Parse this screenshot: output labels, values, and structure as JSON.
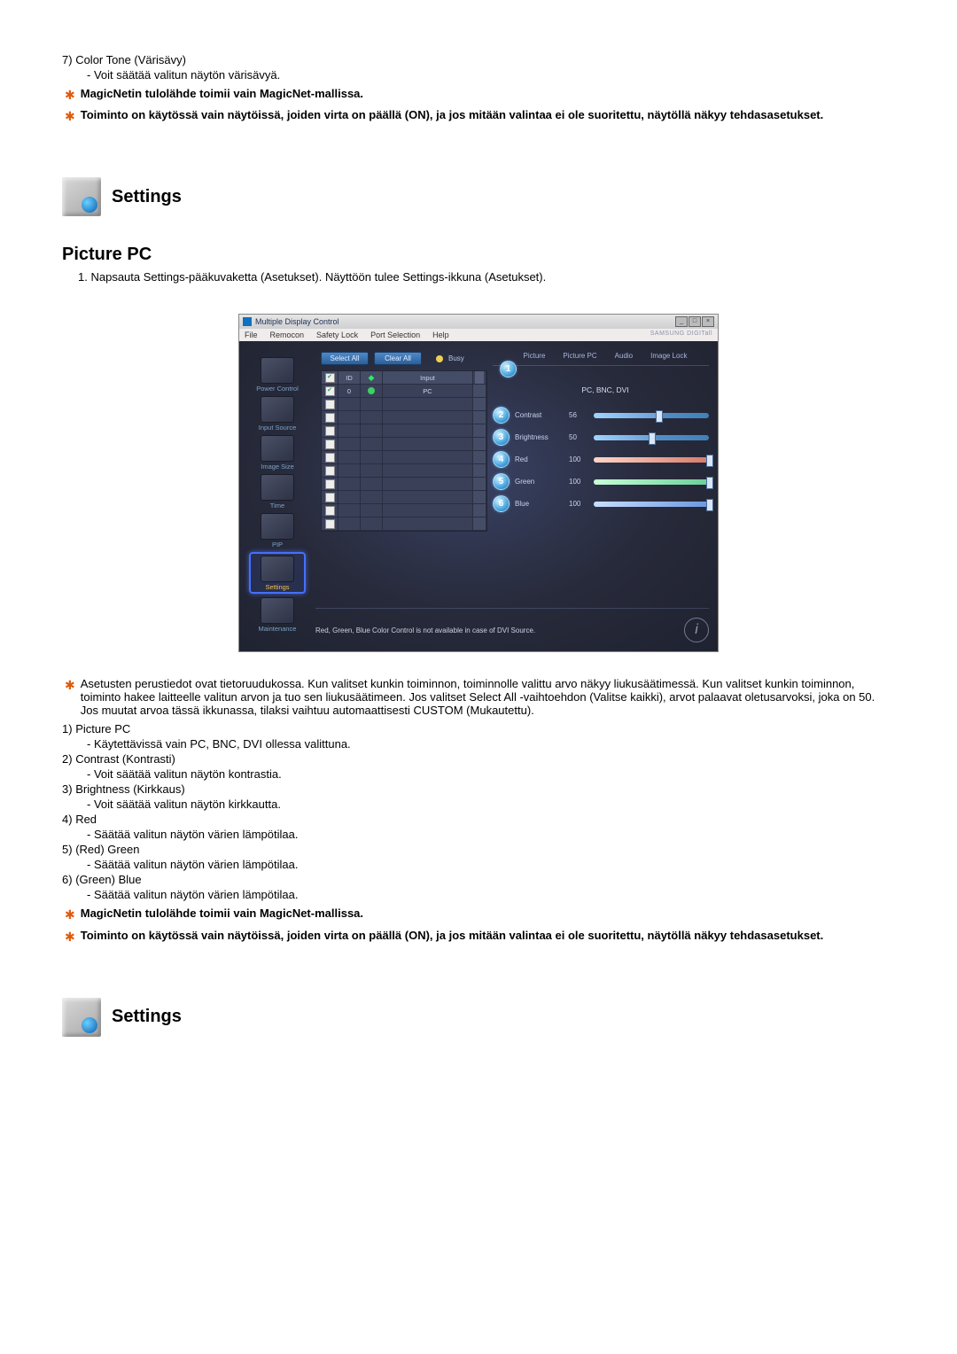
{
  "intro": {
    "item7_num": "7)",
    "item7_title": "Color Tone (Värisävy)",
    "item7_desc": "- Voit säätää valitun näytön värisävyä.",
    "star1": "MagicNetin tulolähde toimii vain MagicNet-mallissa.",
    "star2": "Toiminto on käytössä vain näytöissä, joiden virta on päällä (ON), ja jos mitään valintaa ei ole suoritettu, näytöllä näkyy tehdasasetukset."
  },
  "settings_heading": "Settings",
  "picture_pc_heading": "Picture PC",
  "step1": "Napsauta Settings-pääkuvaketta (Asetukset). Näyttöön tulee Settings-ikkuna (Asetukset).",
  "app": {
    "title": "Multiple Display Control",
    "menu": [
      "File",
      "Remocon",
      "Safety Lock",
      "Port Selection",
      "Help"
    ],
    "brand": "SAMSUNG DIGITall",
    "nav": [
      {
        "label": "Power Control"
      },
      {
        "label": "Input Source"
      },
      {
        "label": "Image Size"
      },
      {
        "label": "Time"
      },
      {
        "label": "PIP"
      },
      {
        "label": "Settings"
      },
      {
        "label": "Maintenance"
      }
    ],
    "select_all": "Select All",
    "clear_all": "Clear All",
    "busy": "Busy",
    "grid_headers": {
      "id": "ID",
      "input": "Input"
    },
    "grid_row_id": "0",
    "grid_row_input": "PC",
    "top_links": [
      "Picture",
      "Picture PC",
      "Audio",
      "Image Lock"
    ],
    "source_line": "PC, BNC, DVI",
    "sliders": [
      {
        "num": "2",
        "label": "Contrast",
        "val": "56"
      },
      {
        "num": "3",
        "label": "Brightness",
        "val": "50"
      },
      {
        "num": "4",
        "label": "Red",
        "val": "100",
        "cls": "red"
      },
      {
        "num": "5",
        "label": "Green",
        "val": "100",
        "cls": "green"
      },
      {
        "num": "6",
        "label": "Blue",
        "val": "100",
        "cls": "blue"
      }
    ],
    "circle1": "1",
    "note": "Red, Green, Blue Color Control is not available in case of DVI Source."
  },
  "below": {
    "starA": "Asetusten perustiedot ovat tietoruudukossa. Kun valitset kunkin toiminnon, toiminnolle valittu arvo näkyy liukusäätimessä. Kun valitset kunkin toiminnon, toiminto hakee laitteelle valitun arvon ja tuo sen liukusäätimeen. Jos valitset Select All -vaihtoehdon (Valitse kaikki), arvot palaavat oletusarvoksi, joka on 50. Jos muutat arvoa tässä ikkunassa, tilaksi vaihtuu automaattisesti CUSTOM (Mukautettu).",
    "items": [
      {
        "n": "1)",
        "t": "Picture PC",
        "d": "- Käytettävissä vain PC, BNC, DVI ollessa valittuna."
      },
      {
        "n": "2)",
        "t": "Contrast (Kontrasti)",
        "d": "- Voit säätää valitun näytön kontrastia."
      },
      {
        "n": "3)",
        "t": "Brightness (Kirkkaus)",
        "d": "- Voit säätää valitun näytön kirkkautta."
      },
      {
        "n": "4)",
        "t": "Red",
        "d": "- Säätää valitun näytön värien lämpötilaa."
      },
      {
        "n": "5)",
        "t": "(Red) Green",
        "d": "- Säätää valitun näytön värien lämpötilaa."
      },
      {
        "n": "6)",
        "t": "(Green) Blue",
        "d": "- Säätää valitun näytön värien lämpötilaa."
      }
    ],
    "starB": "MagicNetin tulolähde toimii vain MagicNet-mallissa.",
    "starC": "Toiminto on käytössä vain näytöissä, joiden virta on päällä (ON), ja jos mitään valintaa ei ole suoritettu, näytöllä näkyy tehdasasetukset."
  }
}
